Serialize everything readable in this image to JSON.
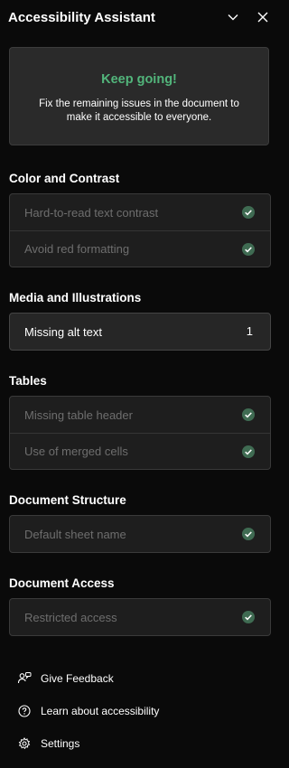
{
  "header": {
    "title": "Accessibility Assistant",
    "collapse_icon": "chevron-down-icon",
    "close_icon": "close-icon"
  },
  "banner": {
    "headline": "Keep going!",
    "message": "Fix the remaining issues in the document to make it accessible to everyone."
  },
  "sections": {
    "color_contrast": {
      "title": "Color and Contrast",
      "items": [
        "Hard-to-read text contrast",
        "Avoid red formatting"
      ]
    },
    "media": {
      "title": "Media and Illustrations",
      "items": [
        {
          "label": "Missing alt text",
          "count": "1"
        }
      ]
    },
    "tables": {
      "title": "Tables",
      "items": [
        "Missing table header",
        "Use of merged cells"
      ]
    },
    "structure": {
      "title": "Document Structure",
      "items": [
        "Default sheet name"
      ]
    },
    "access": {
      "title": "Document Access",
      "items": [
        "Restricted access"
      ]
    }
  },
  "footer": {
    "feedback": "Give Feedback",
    "learn": "Learn about accessibility",
    "settings": "Settings"
  },
  "colors": {
    "accent_green": "#52b57b",
    "check_circle": "#3f6b52"
  }
}
